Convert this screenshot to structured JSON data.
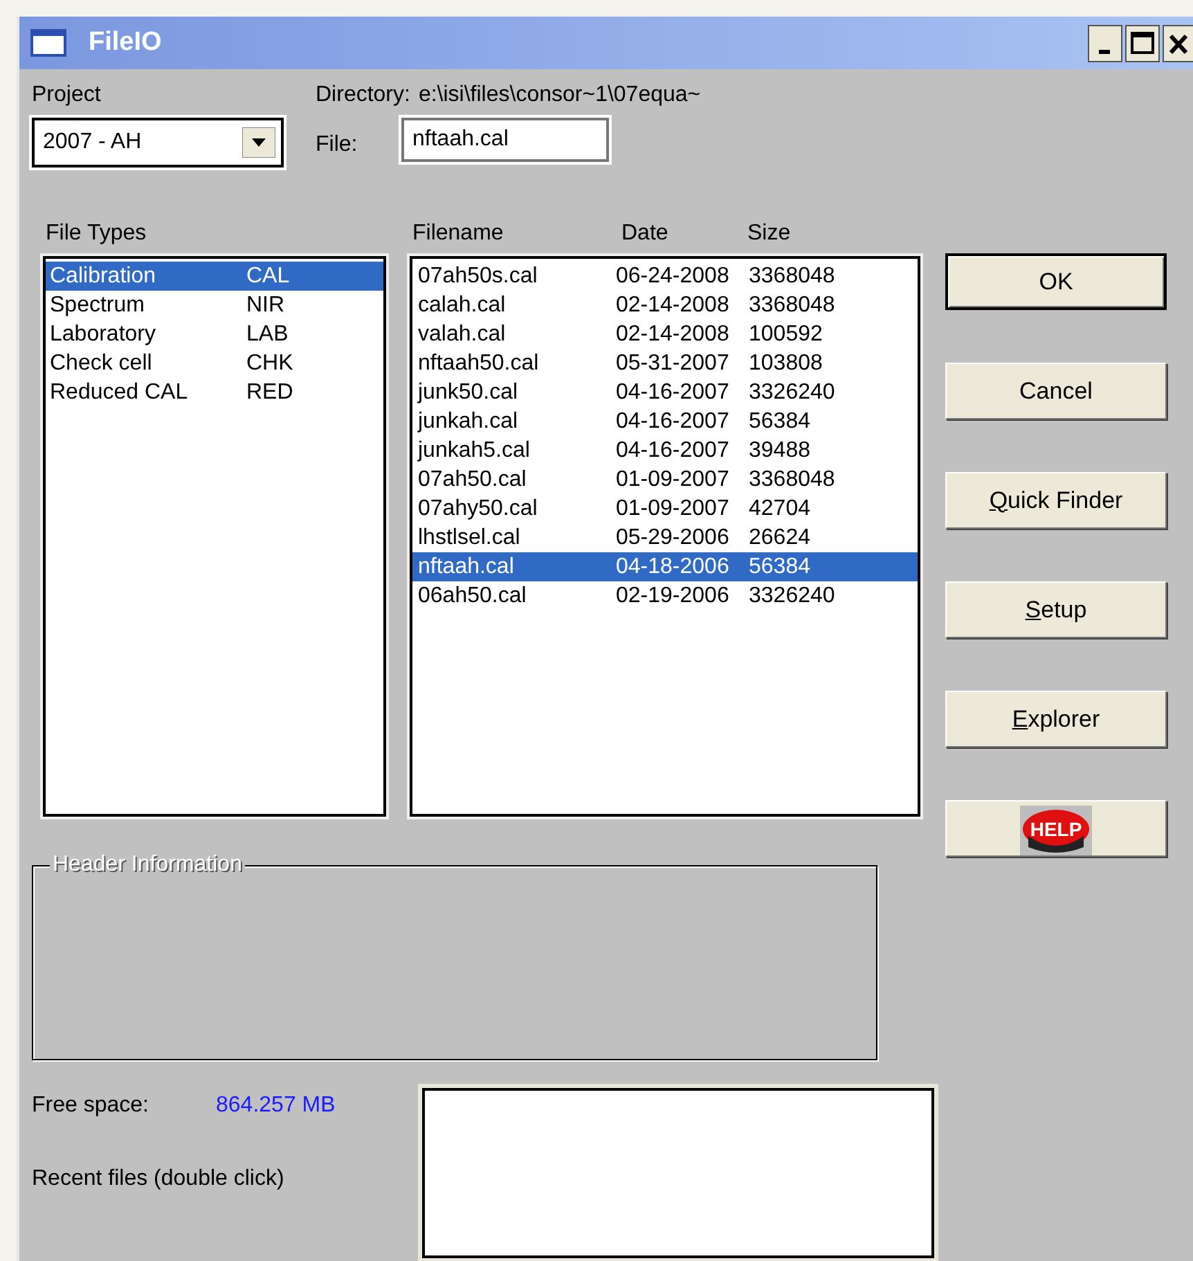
{
  "window": {
    "title": "FileIO"
  },
  "project": {
    "label": "Project",
    "value": "2007 - AH"
  },
  "directory": {
    "label": "Directory:",
    "value": "e:\\isi\\files\\consor~1\\07equa~"
  },
  "file": {
    "label": "File:",
    "value": "nftaah.cal"
  },
  "file_types": {
    "label": "File Types",
    "items": [
      {
        "name": "Calibration",
        "code": "CAL",
        "selected": true
      },
      {
        "name": "Spectrum",
        "code": "NIR",
        "selected": false
      },
      {
        "name": "Laboratory",
        "code": "LAB",
        "selected": false
      },
      {
        "name": "Check cell",
        "code": "CHK",
        "selected": false
      },
      {
        "name": "Reduced CAL",
        "code": "RED",
        "selected": false
      }
    ]
  },
  "files": {
    "columns": [
      "Filename",
      "Date",
      "Size"
    ],
    "rows": [
      {
        "name": "07ah50s.cal",
        "date": "06-24-2008",
        "size": "3368048",
        "selected": false
      },
      {
        "name": "calah.cal",
        "date": "02-14-2008",
        "size": "3368048",
        "selected": false
      },
      {
        "name": "valah.cal",
        "date": "02-14-2008",
        "size": "100592",
        "selected": false
      },
      {
        "name": "nftaah50.cal",
        "date": "05-31-2007",
        "size": "103808",
        "selected": false
      },
      {
        "name": "junk50.cal",
        "date": "04-16-2007",
        "size": "3326240",
        "selected": false
      },
      {
        "name": "junkah.cal",
        "date": "04-16-2007",
        "size": "56384",
        "selected": false
      },
      {
        "name": "junkah5.cal",
        "date": "04-16-2007",
        "size": "39488",
        "selected": false
      },
      {
        "name": "07ah50.cal",
        "date": "01-09-2007",
        "size": "3368048",
        "selected": false
      },
      {
        "name": "07ahy50.cal",
        "date": "01-09-2007",
        "size": "42704",
        "selected": false
      },
      {
        "name": "lhstlsel.cal",
        "date": "05-29-2006",
        "size": "26624",
        "selected": false
      },
      {
        "name": "nftaah.cal",
        "date": "04-18-2006",
        "size": "56384",
        "selected": true
      },
      {
        "name": "06ah50.cal",
        "date": "02-19-2006",
        "size": "3326240",
        "selected": false
      }
    ]
  },
  "buttons": [
    {
      "kind": "text",
      "label": "OK",
      "default": true,
      "mnemonic": false
    },
    {
      "kind": "text",
      "label": "Cancel",
      "default": false,
      "mnemonic": false
    },
    {
      "kind": "text",
      "label": "Quick Finder",
      "default": false,
      "mnemonic": true
    },
    {
      "kind": "text",
      "label": "Setup",
      "default": false,
      "mnemonic": true
    },
    {
      "kind": "text",
      "label": "Explorer",
      "default": false,
      "mnemonic": true
    },
    {
      "kind": "help",
      "label": "HELP",
      "default": false
    }
  ],
  "header_information": {
    "label": "Header Information"
  },
  "free_space": {
    "label": "Free space:",
    "value": "864.257 MB"
  },
  "recent_files": {
    "label": "Recent files (double click)"
  }
}
